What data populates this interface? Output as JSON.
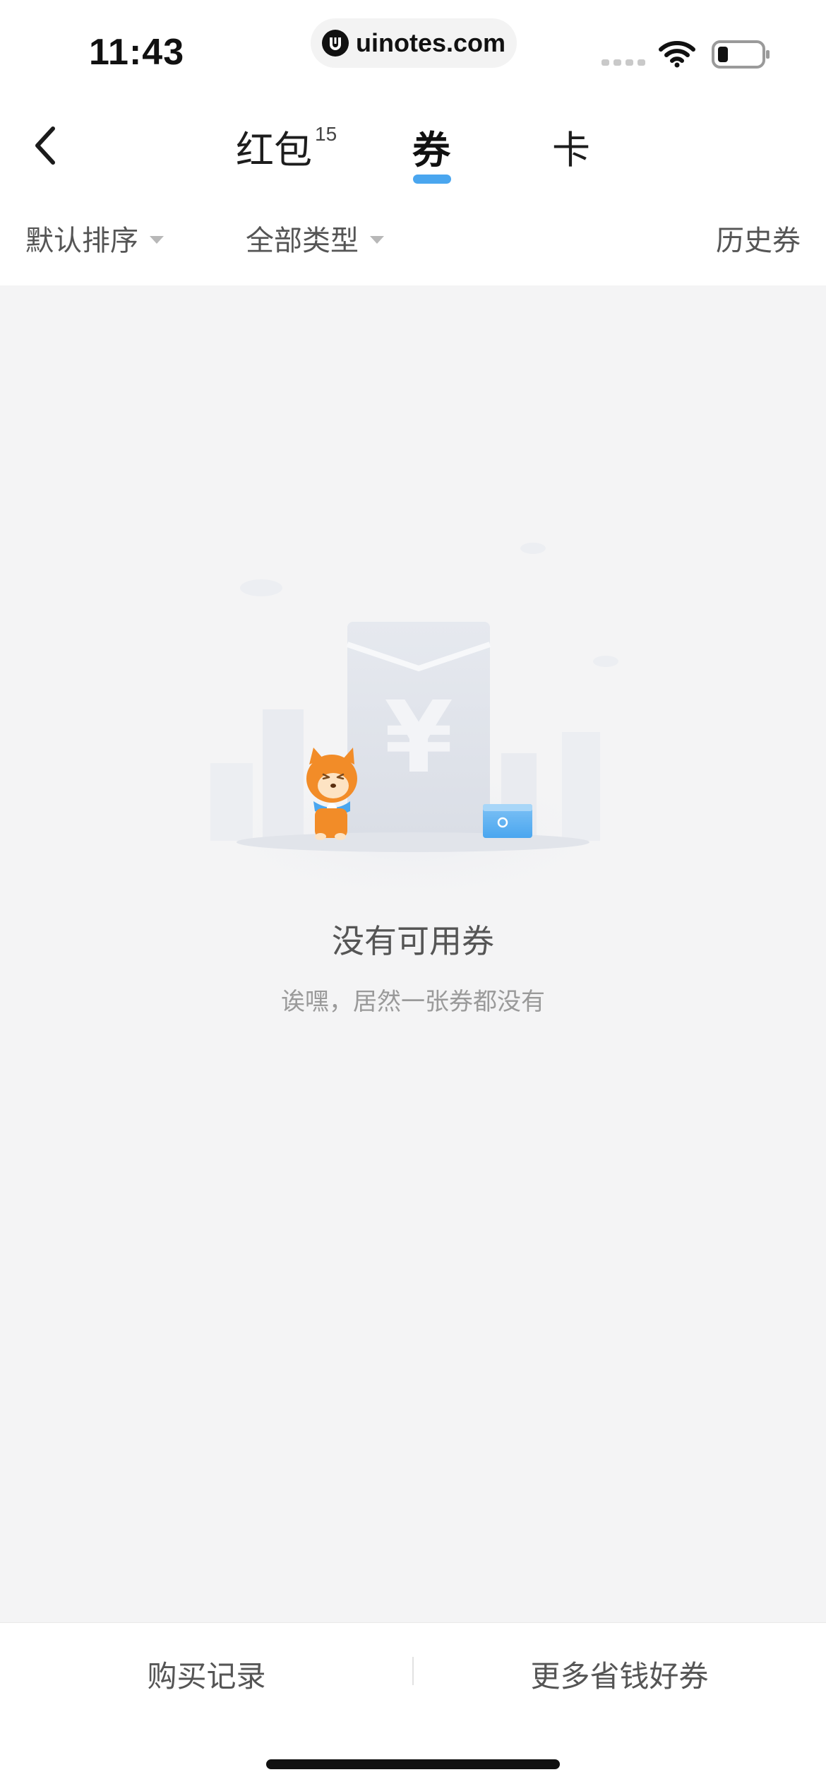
{
  "status_bar": {
    "time": "11:43",
    "url": "uinotes.com",
    "icons": [
      "signal-icon",
      "wifi-icon",
      "battery-icon"
    ]
  },
  "nav": {
    "back_icon": "chevron-left-icon",
    "tabs": [
      {
        "label": "红包",
        "badge": "15",
        "active": false
      },
      {
        "label": "券",
        "active": true
      },
      {
        "label": "卡",
        "active": false
      }
    ],
    "accent_color": "#4aa6ef"
  },
  "filters": {
    "sort_label": "默认排序",
    "type_label": "全部类型",
    "history_label": "历史券"
  },
  "empty_state": {
    "title": "没有可用券",
    "subtitle": "诶嘿，居然一张券都没有",
    "illustration_icon": "empty-coupon-illustration"
  },
  "bottom_bar": {
    "left_label": "购买记录",
    "right_label": "更多省钱好券"
  }
}
